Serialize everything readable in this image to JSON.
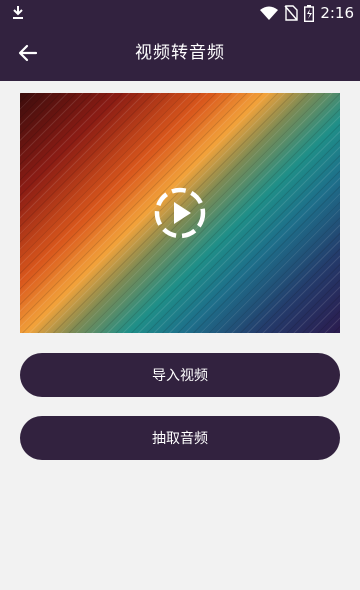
{
  "status_bar": {
    "time": "2:16",
    "icons": [
      "download-icon",
      "wifi-icon",
      "no-sim-icon",
      "battery-charging-icon"
    ]
  },
  "app_bar": {
    "title": "视频转音频",
    "back_icon": "arrow-left-icon"
  },
  "preview": {
    "play_icon": "play-circle-dashed-icon"
  },
  "buttons": {
    "import_label": "导入视频",
    "extract_label": "抽取音频"
  },
  "colors": {
    "primary": "#32223f",
    "background": "#f2f2f2",
    "on_primary": "#ffffff"
  }
}
